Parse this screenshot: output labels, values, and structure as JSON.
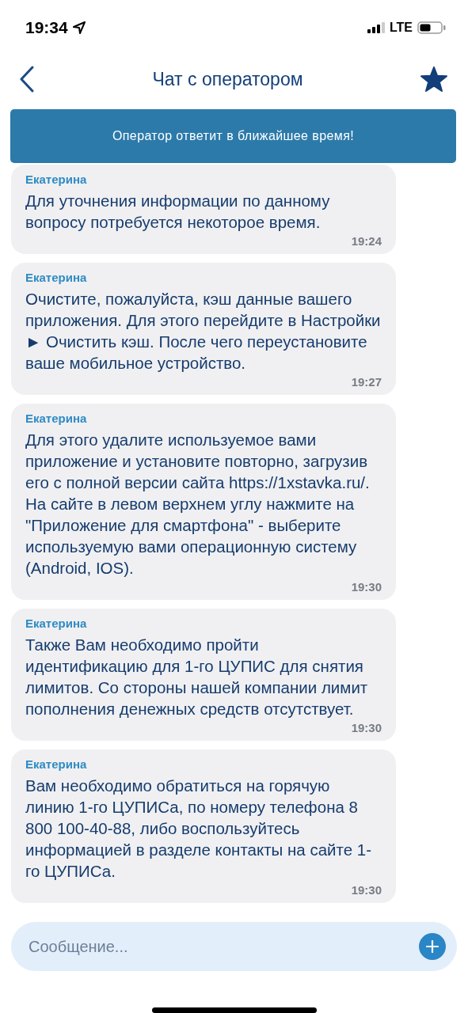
{
  "status_bar": {
    "time": "19:34",
    "network": "LTE"
  },
  "header": {
    "title": "Чат с оператором",
    "favorite": true
  },
  "banner": "Оператор ответит в ближайшее время!",
  "messages": [
    {
      "sender": "Екатерина",
      "text": "Для уточнения информации по данному вопросу потребуется некоторое время.",
      "time": "19:24"
    },
    {
      "sender": "Екатерина",
      "text": "Очистите, пожалуйста, кэш данные вашего приложения. Для этого перейдите в Настройки ► Очистить кэш. После чего переустановите ваше мобильное устройство.",
      "time": "19:27"
    },
    {
      "sender": "Екатерина",
      "text": "Для этого удалите используемое вами приложение и установите повторно, загрузив его с полной версии сайта https://1xstavka.ru/. На сайте в левом верхнем углу нажмите на \"Приложение для смартфона\" - выберите используемую вами операционную систему (Android, IOS).",
      "time": "19:30"
    },
    {
      "sender": "Екатерина",
      "text": "Также Вам необходимо пройти идентификацию для 1-го ЦУПИС для снятия лимитов. Со стороны нашей компании лимит пополнения денежных средств отсутствует.",
      "time": "19:30"
    },
    {
      "sender": "Екатерина",
      "text": "Вам необходимо обратиться на горячую линию 1-го ЦУПИСа, по номеру телефона 8 800 100-40-88, либо воспользуйтесь информацией в разделе контакты на сайте 1-го ЦУПИСа.",
      "time": "19:30"
    }
  ],
  "composer": {
    "placeholder": "Сообщение..."
  }
}
